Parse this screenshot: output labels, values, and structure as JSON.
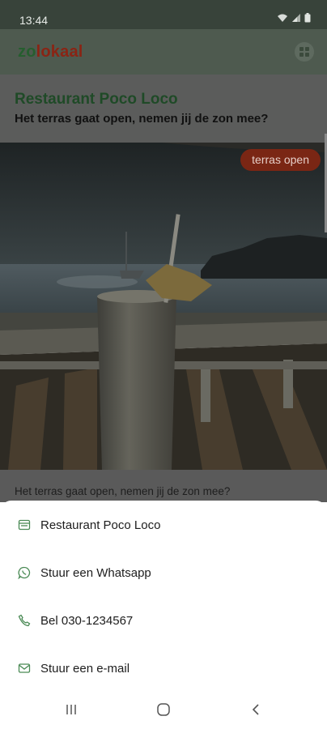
{
  "status_bar": {
    "time": "13:44"
  },
  "header": {
    "logo_part1": "zo",
    "logo_part2": "lokaal",
    "menu_icon": "grid-icon"
  },
  "card": {
    "title": "Restaurant Poco Loco",
    "subtitle": "Het terras gaat open, nemen jij de zon mee?",
    "badge": "terras open",
    "description": "Het terras gaat open, nemen jij de zon mee?"
  },
  "sheet": {
    "items": [
      {
        "label": "Restaurant Poco Loco",
        "icon": "store-icon"
      },
      {
        "label": "Stuur een Whatsapp",
        "icon": "whatsapp-icon"
      },
      {
        "label": "Bel 030-1234567",
        "icon": "phone-icon"
      },
      {
        "label": "Stuur een e-mail",
        "icon": "mail-icon"
      }
    ]
  },
  "colors": {
    "accent": "#4a8a55",
    "brand_green": "#265e2f",
    "brand_red": "#8a2414",
    "badge": "#7a2614"
  },
  "navbar": {
    "icons": [
      "recent-apps-icon",
      "home-icon",
      "back-icon"
    ]
  }
}
